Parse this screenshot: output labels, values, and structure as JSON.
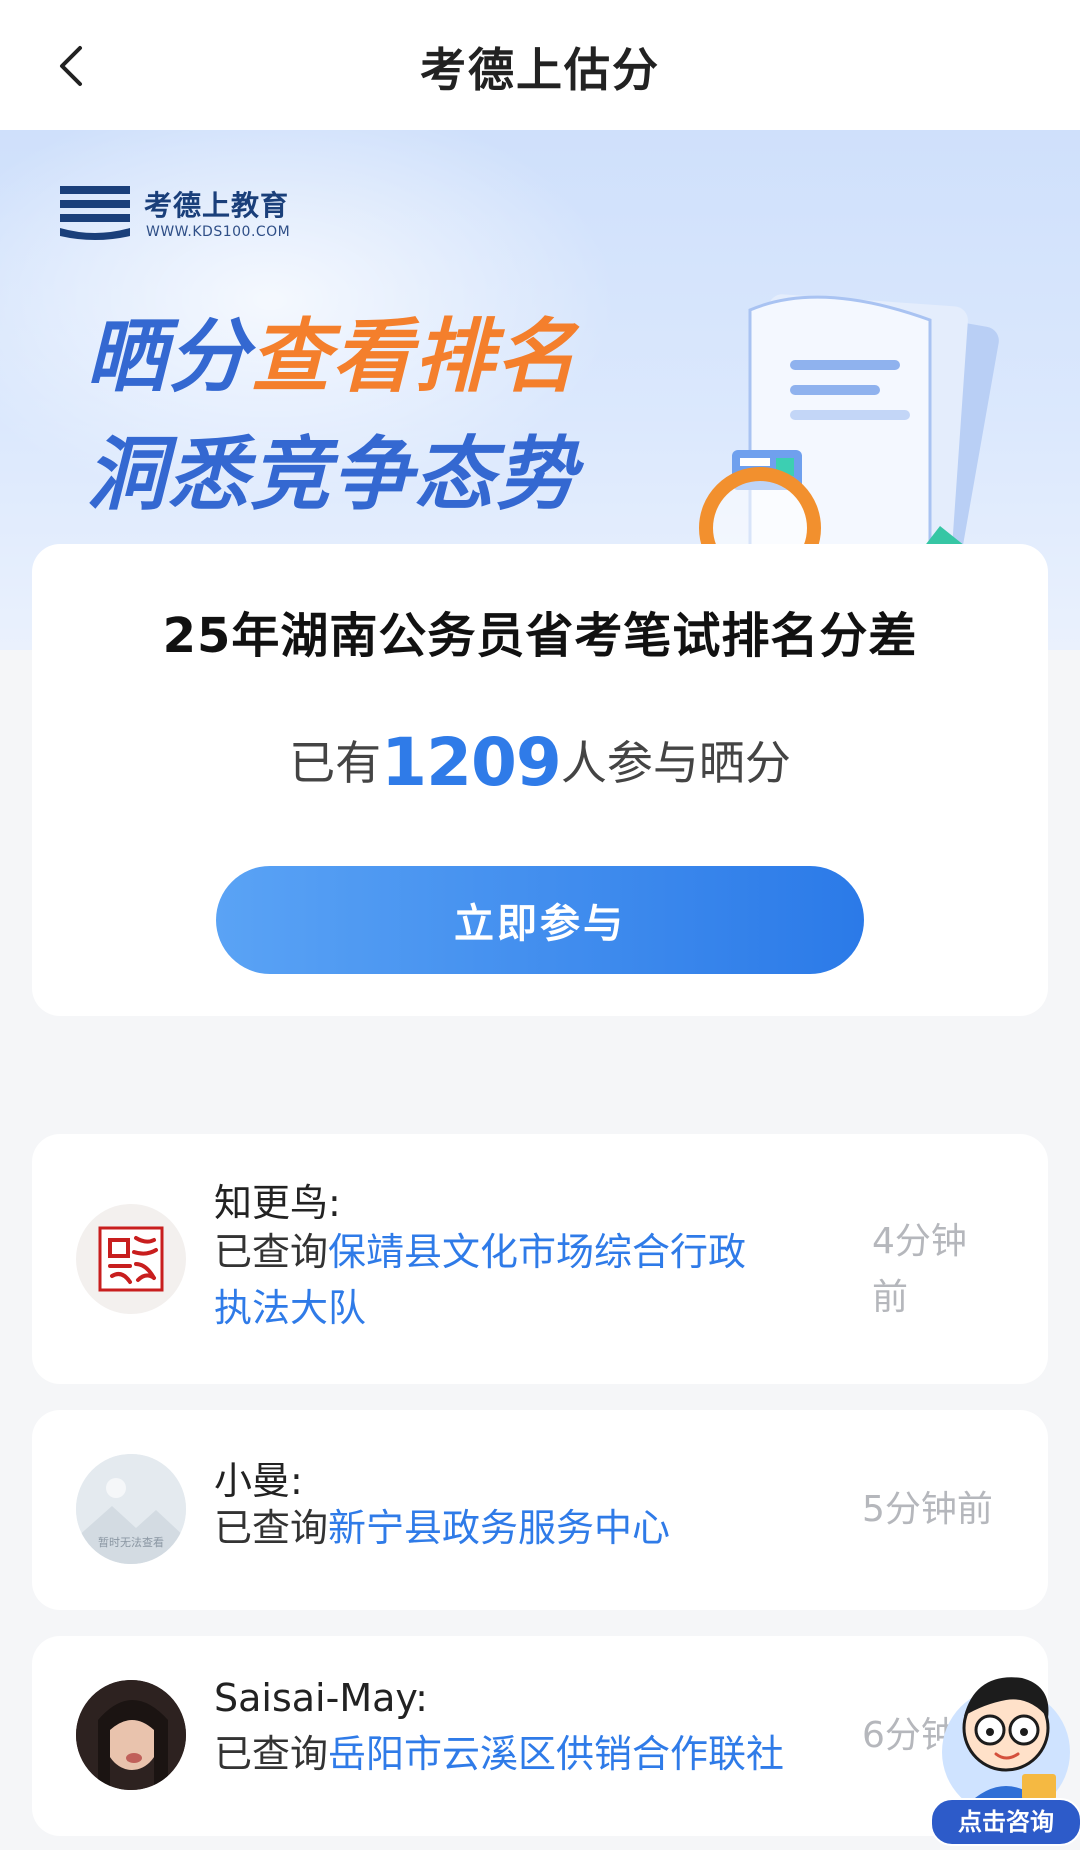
{
  "header": {
    "title": "考德上估分",
    "back_icon": "chevron-left-icon"
  },
  "banner": {
    "logo_name": "考德上教育",
    "logo_url": "WWW.KDS100.COM",
    "slogan_line1_part1": "晒分",
    "slogan_line1_part2": "查看排名",
    "slogan_line2": "洞悉竞争态势",
    "illustration": "magnifier-document-chart-illustration"
  },
  "main_card": {
    "exam_title": "25年湖南公务员省考笔试排名分差",
    "count_prefix": "已有",
    "count": "1209",
    "count_suffix": "人参与晒分",
    "join_button": "立即参与"
  },
  "feed": [
    {
      "user": "知更鸟:",
      "action": "已查询",
      "org": "保靖县文化市场综合行政执法大队",
      "time_line1": "4分钟",
      "time_line2": "前",
      "avatar": "guotai-minan-avatar"
    },
    {
      "user": "小曼:",
      "action": "已查询",
      "org": "新宁县政务服务中心",
      "time": "5分钟前",
      "avatar": "placeholder-avatar",
      "avatar_placeholder_text": "暂时无法查看"
    },
    {
      "user": "Saisai-May:",
      "action": "已查询",
      "org": "岳阳市云溪区供销合作联社",
      "time": "6分钟前",
      "avatar": "photo-avatar"
    }
  ],
  "consult": {
    "label": "点击咨询",
    "icon": "cartoon-teacher-icon"
  },
  "colors": {
    "accent": "#2f7be8",
    "orange": "#f47f2c",
    "banner_blue": "#3468d1"
  }
}
